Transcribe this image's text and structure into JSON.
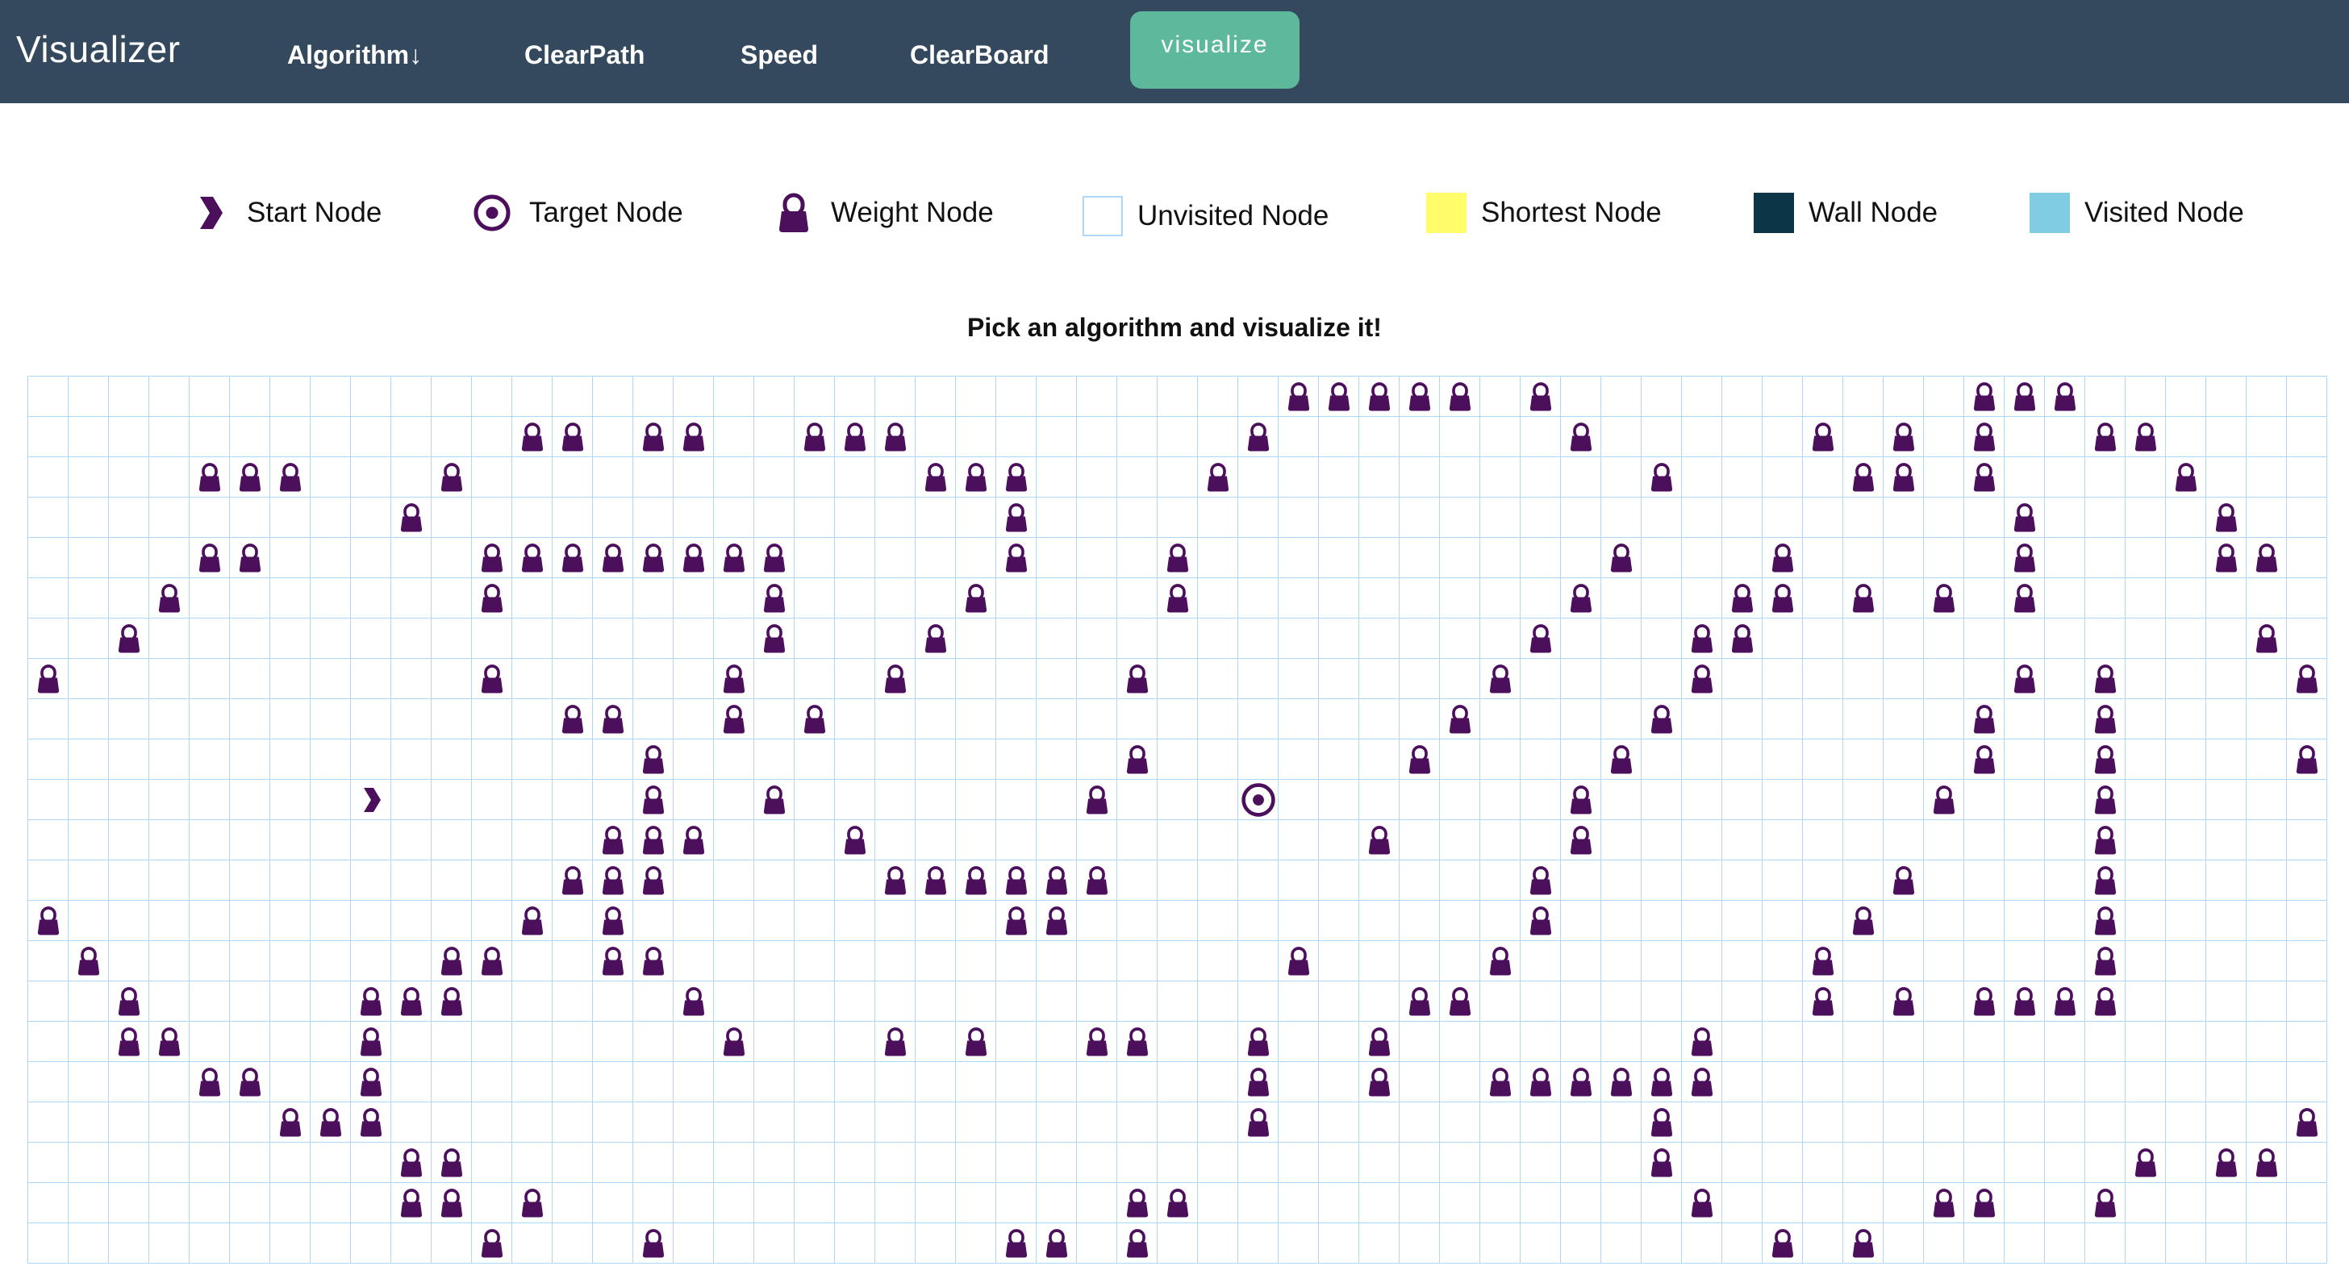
{
  "navbar": {
    "brand": "Visualizer",
    "items": [
      {
        "label": "Algorithm↓"
      },
      {
        "label": "ClearPath"
      },
      {
        "label": "Speed"
      },
      {
        "label": "ClearBoard"
      }
    ],
    "visualize_label": "visualize",
    "colors": {
      "background": "#34495e",
      "visualize_button": "#5eb99c"
    }
  },
  "legend": [
    {
      "label": "Start Node",
      "icon": "chevron-right-icon"
    },
    {
      "label": "Target Node",
      "icon": "target-icon"
    },
    {
      "label": "Weight Node",
      "icon": "weight-icon"
    },
    {
      "label": "Unvisited Node",
      "color": "#ffffff"
    },
    {
      "label": "Shortest Node",
      "color": "#fffe6a"
    },
    {
      "label": "Wall Node",
      "color": "#0c3547"
    },
    {
      "label": "Visited Node",
      "color": "#7fcce3"
    }
  ],
  "instruction": "Pick an algorithm and visualize it!",
  "grid": {
    "rows": 22,
    "cols": 57,
    "node_color": "#4b0f5c",
    "start": [
      10,
      8
    ],
    "target": [
      10,
      30
    ],
    "weights": [
      [
        0,
        31
      ],
      [
        0,
        32
      ],
      [
        0,
        33
      ],
      [
        0,
        34
      ],
      [
        0,
        35
      ],
      [
        0,
        37
      ],
      [
        0,
        48
      ],
      [
        0,
        49
      ],
      [
        0,
        50
      ],
      [
        1,
        12
      ],
      [
        1,
        13
      ],
      [
        1,
        15
      ],
      [
        1,
        16
      ],
      [
        1,
        19
      ],
      [
        1,
        20
      ],
      [
        1,
        21
      ],
      [
        1,
        30
      ],
      [
        1,
        38
      ],
      [
        1,
        44
      ],
      [
        1,
        46
      ],
      [
        1,
        48
      ],
      [
        1,
        51
      ],
      [
        1,
        52
      ],
      [
        2,
        4
      ],
      [
        2,
        5
      ],
      [
        2,
        6
      ],
      [
        2,
        10
      ],
      [
        2,
        22
      ],
      [
        2,
        23
      ],
      [
        2,
        24
      ],
      [
        2,
        29
      ],
      [
        2,
        40
      ],
      [
        2,
        45
      ],
      [
        2,
        46
      ],
      [
        2,
        48
      ],
      [
        2,
        53
      ],
      [
        3,
        9
      ],
      [
        3,
        24
      ],
      [
        3,
        49
      ],
      [
        3,
        54
      ],
      [
        4,
        4
      ],
      [
        4,
        5
      ],
      [
        4,
        11
      ],
      [
        4,
        12
      ],
      [
        4,
        13
      ],
      [
        4,
        14
      ],
      [
        4,
        15
      ],
      [
        4,
        16
      ],
      [
        4,
        17
      ],
      [
        4,
        18
      ],
      [
        4,
        24
      ],
      [
        4,
        28
      ],
      [
        4,
        39
      ],
      [
        4,
        43
      ],
      [
        4,
        49
      ],
      [
        4,
        54
      ],
      [
        4,
        55
      ],
      [
        5,
        3
      ],
      [
        5,
        11
      ],
      [
        5,
        18
      ],
      [
        5,
        23
      ],
      [
        5,
        28
      ],
      [
        5,
        38
      ],
      [
        5,
        42
      ],
      [
        5,
        43
      ],
      [
        5,
        45
      ],
      [
        5,
        47
      ],
      [
        5,
        49
      ],
      [
        6,
        2
      ],
      [
        6,
        18
      ],
      [
        6,
        22
      ],
      [
        6,
        37
      ],
      [
        6,
        41
      ],
      [
        6,
        42
      ],
      [
        6,
        55
      ],
      [
        7,
        0
      ],
      [
        7,
        11
      ],
      [
        7,
        17
      ],
      [
        7,
        21
      ],
      [
        7,
        27
      ],
      [
        7,
        36
      ],
      [
        7,
        41
      ],
      [
        7,
        49
      ],
      [
        7,
        51
      ],
      [
        7,
        56
      ],
      [
        8,
        13
      ],
      [
        8,
        14
      ],
      [
        8,
        17
      ],
      [
        8,
        19
      ],
      [
        8,
        35
      ],
      [
        8,
        40
      ],
      [
        8,
        48
      ],
      [
        8,
        51
      ],
      [
        9,
        15
      ],
      [
        9,
        27
      ],
      [
        9,
        34
      ],
      [
        9,
        39
      ],
      [
        9,
        48
      ],
      [
        9,
        51
      ],
      [
        9,
        56
      ],
      [
        10,
        15
      ],
      [
        10,
        18
      ],
      [
        10,
        26
      ],
      [
        10,
        38
      ],
      [
        10,
        47
      ],
      [
        10,
        51
      ],
      [
        11,
        14
      ],
      [
        11,
        15
      ],
      [
        11,
        16
      ],
      [
        11,
        20
      ],
      [
        11,
        33
      ],
      [
        11,
        38
      ],
      [
        11,
        51
      ],
      [
        12,
        13
      ],
      [
        12,
        14
      ],
      [
        12,
        15
      ],
      [
        12,
        21
      ],
      [
        12,
        22
      ],
      [
        12,
        23
      ],
      [
        12,
        24
      ],
      [
        12,
        25
      ],
      [
        12,
        26
      ],
      [
        12,
        37
      ],
      [
        12,
        46
      ],
      [
        12,
        51
      ],
      [
        13,
        0
      ],
      [
        13,
        12
      ],
      [
        13,
        14
      ],
      [
        13,
        24
      ],
      [
        13,
        25
      ],
      [
        13,
        37
      ],
      [
        13,
        45
      ],
      [
        13,
        51
      ],
      [
        14,
        1
      ],
      [
        14,
        10
      ],
      [
        14,
        11
      ],
      [
        14,
        14
      ],
      [
        14,
        15
      ],
      [
        14,
        31
      ],
      [
        14,
        36
      ],
      [
        14,
        44
      ],
      [
        14,
        51
      ],
      [
        15,
        2
      ],
      [
        15,
        8
      ],
      [
        15,
        9
      ],
      [
        15,
        10
      ],
      [
        15,
        16
      ],
      [
        15,
        34
      ],
      [
        15,
        35
      ],
      [
        15,
        44
      ],
      [
        15,
        46
      ],
      [
        15,
        48
      ],
      [
        15,
        49
      ],
      [
        15,
        50
      ],
      [
        15,
        51
      ],
      [
        16,
        2
      ],
      [
        16,
        3
      ],
      [
        16,
        8
      ],
      [
        16,
        17
      ],
      [
        16,
        21
      ],
      [
        16,
        23
      ],
      [
        16,
        26
      ],
      [
        16,
        27
      ],
      [
        16,
        30
      ],
      [
        16,
        33
      ],
      [
        16,
        41
      ],
      [
        17,
        4
      ],
      [
        17,
        5
      ],
      [
        17,
        8
      ],
      [
        17,
        30
      ],
      [
        17,
        33
      ],
      [
        17,
        36
      ],
      [
        17,
        37
      ],
      [
        17,
        38
      ],
      [
        17,
        39
      ],
      [
        17,
        40
      ],
      [
        17,
        41
      ],
      [
        18,
        6
      ],
      [
        18,
        7
      ],
      [
        18,
        8
      ],
      [
        18,
        30
      ],
      [
        18,
        40
      ],
      [
        18,
        56
      ],
      [
        19,
        9
      ],
      [
        19,
        10
      ],
      [
        19,
        40
      ],
      [
        19,
        52
      ],
      [
        19,
        54
      ],
      [
        19,
        55
      ],
      [
        20,
        9
      ],
      [
        20,
        10
      ],
      [
        20,
        12
      ],
      [
        20,
        27
      ],
      [
        20,
        28
      ],
      [
        20,
        41
      ],
      [
        20,
        47
      ],
      [
        20,
        48
      ],
      [
        20,
        51
      ],
      [
        21,
        11
      ],
      [
        21,
        15
      ],
      [
        21,
        24
      ],
      [
        21,
        25
      ],
      [
        21,
        27
      ],
      [
        21,
        43
      ],
      [
        21,
        45
      ]
    ]
  }
}
